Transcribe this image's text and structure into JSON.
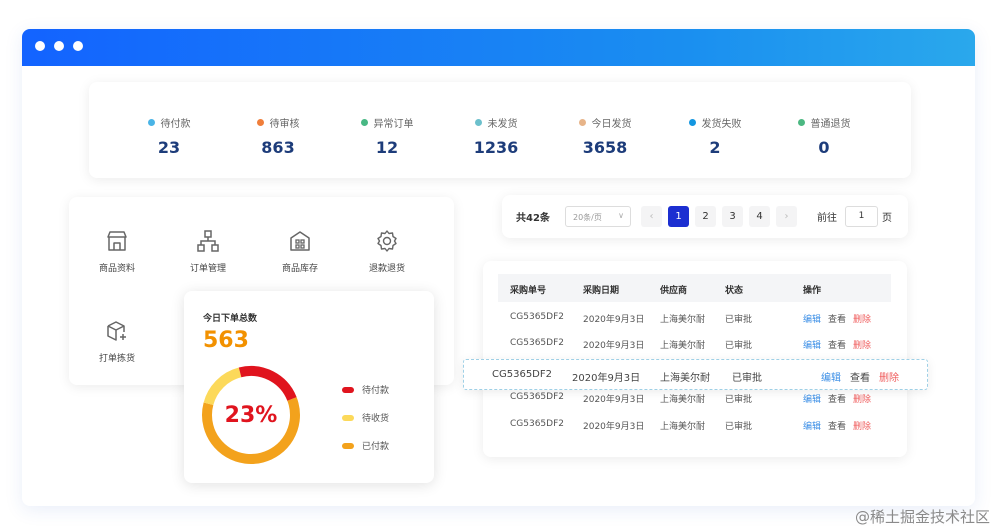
{
  "stats": [
    {
      "label": "待付款",
      "value": "23",
      "color": "#4ab4e6"
    },
    {
      "label": "待审核",
      "value": "863",
      "color": "#f07e3a"
    },
    {
      "label": "异常订单",
      "value": "12",
      "color": "#48b884"
    },
    {
      "label": "未发货",
      "value": "1236",
      "color": "#6cc0cc"
    },
    {
      "label": "今日发货",
      "value": "3658",
      "color": "#e7b489"
    },
    {
      "label": "发货失败",
      "value": "2",
      "color": "#1396e0"
    },
    {
      "label": "普通退货",
      "value": "0",
      "color": "#4cb882"
    }
  ],
  "shortcuts": [
    {
      "label": "商品资料",
      "icon": "store-icon"
    },
    {
      "label": "订单管理",
      "icon": "hierarchy-icon"
    },
    {
      "label": "商品库存",
      "icon": "warehouse-icon"
    },
    {
      "label": "退款退货",
      "icon": "settings-gear-icon"
    },
    {
      "label": "打单拣货",
      "icon": "package-add-icon"
    }
  ],
  "orders_card": {
    "title": "今日下单总数",
    "total": "563",
    "percent_label": "23%",
    "legend": [
      {
        "label": "待付款",
        "color": "#e0141e"
      },
      {
        "label": "待收货",
        "color": "#fcd95a"
      },
      {
        "label": "已付款",
        "color": "#f3a21c"
      }
    ],
    "ring": {
      "red_fraction": 0.23,
      "yellow_fraction": 0.17,
      "orange_fraction": 0.6
    }
  },
  "pager": {
    "total": "共42条",
    "page_size": "20条/页",
    "page_size_arrow": "∨",
    "prev": "‹",
    "next": "›",
    "pages": [
      "1",
      "2",
      "3",
      "4"
    ],
    "current": "1",
    "goto_label": "前往",
    "goto_value": "1",
    "page_suffix": "页"
  },
  "table": {
    "headers": [
      "采购单号",
      "采购日期",
      "供应商",
      "状态",
      "操作"
    ],
    "rows": [
      {
        "id": "CG5365DF2",
        "date": "2020年9月3日",
        "supplier": "上海美尔耐",
        "status": "已审批",
        "edit": "编辑",
        "view": "查看",
        "delete": "删除"
      },
      {
        "id": "CG5365DF2",
        "date": "2020年9月3日",
        "supplier": "上海美尔耐",
        "status": "已审批",
        "edit": "编辑",
        "view": "查看",
        "delete": "删除"
      },
      {
        "id": "CG5365DF2",
        "date": "2020年9月3日",
        "supplier": "上海美尔耐",
        "status": "已审批",
        "edit": "编辑",
        "view": "查看",
        "delete": "删除"
      },
      {
        "id": "CG5365DF2",
        "date": "2020年9月3日",
        "supplier": "上海美尔耐",
        "status": "已审批",
        "edit": "编辑",
        "view": "查看",
        "delete": "删除"
      },
      {
        "id": "CG5365DF2",
        "date": "2020年9月3日",
        "supplier": "上海美尔耐",
        "status": "已审批",
        "edit": "编辑",
        "view": "查看",
        "delete": "删除"
      }
    ],
    "highlight_row_index": 2
  },
  "watermark": "@稀土掘金技术社区"
}
